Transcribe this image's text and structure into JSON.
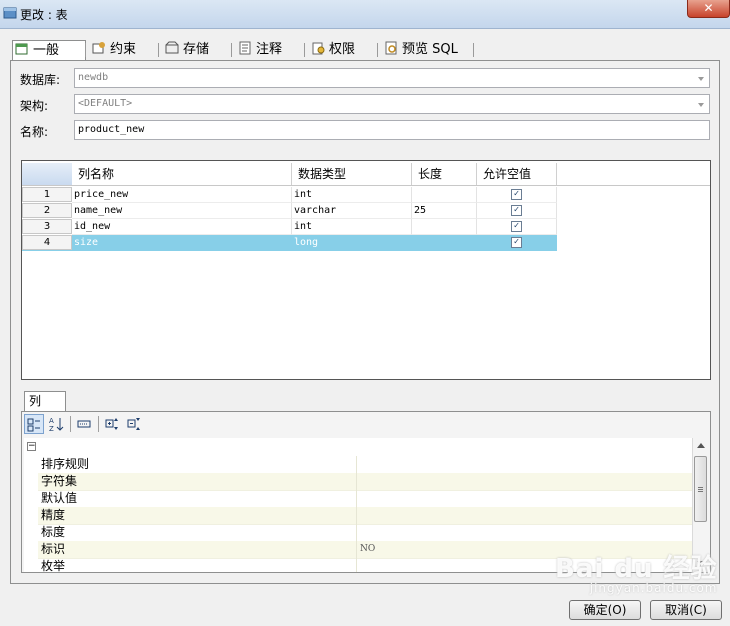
{
  "window": {
    "title": "更改 : 表",
    "close_label": "✕"
  },
  "tabs": [
    {
      "label": "一般",
      "icon": "general-icon"
    },
    {
      "label": "约束",
      "icon": "constraint-icon"
    },
    {
      "label": "存储",
      "icon": "storage-icon"
    },
    {
      "label": "注释",
      "icon": "comment-icon"
    },
    {
      "label": "权限",
      "icon": "permission-icon"
    },
    {
      "label": "预览 SQL",
      "icon": "preview-sql-icon"
    }
  ],
  "form": {
    "database_label": "数据库:",
    "database_value": "newdb",
    "schema_label": "架构:",
    "schema_value": "<DEFAULT>",
    "name_label": "名称:",
    "name_value": "product_new"
  },
  "grid": {
    "headers": [
      "列名称",
      "数据类型",
      "长度",
      "允许空值"
    ],
    "rows": [
      {
        "num": "1",
        "name": "price_new",
        "type": "int",
        "length": "",
        "nullable": true
      },
      {
        "num": "2",
        "name": "name_new",
        "type": "varchar",
        "length": "25",
        "nullable": true
      },
      {
        "num": "3",
        "name": "id_new",
        "type": "int",
        "length": "",
        "nullable": true
      },
      {
        "num": "4",
        "name": "size",
        "type": "long",
        "length": "",
        "nullable": true
      }
    ],
    "selected_row": 4
  },
  "bottom": {
    "tab_label": "列",
    "properties": [
      {
        "name": "排序规则",
        "value": ""
      },
      {
        "name": "字符集",
        "value": ""
      },
      {
        "name": "默认值",
        "value": ""
      },
      {
        "name": "精度",
        "value": ""
      },
      {
        "name": "标度",
        "value": ""
      },
      {
        "name": "标识",
        "value": "NO"
      },
      {
        "name": "枚举",
        "value": ""
      }
    ]
  },
  "buttons": {
    "ok": "确定(O)",
    "cancel": "取消(C)"
  },
  "watermark": {
    "text": "Bai du 经验",
    "sub": "jingyan.baidu.com"
  },
  "colors": {
    "selected_row": "#87cfe8",
    "title_bar": "#c4d6ec",
    "close_button": "#c7432b"
  }
}
